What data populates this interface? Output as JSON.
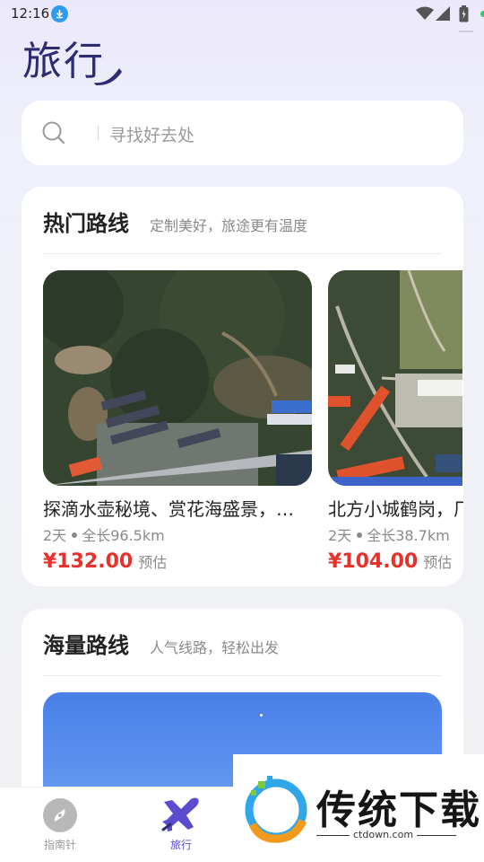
{
  "status_bar": {
    "time": "12:16"
  },
  "header": {
    "title": "旅行"
  },
  "search": {
    "placeholder": "寻找好去处"
  },
  "hot_routes": {
    "title": "热门路线",
    "subtitle": "定制美好，旅途更有温度",
    "items": [
      {
        "name": "探滴水壶秘境、赏花海盛景，…",
        "days": "2天",
        "length": "全长96.5km",
        "price": "¥132.00",
        "estimate": "预估"
      },
      {
        "name": "北方小城鹤岗，厂",
        "days": "2天",
        "length": "全长38.7km",
        "price": "¥104.00",
        "estimate": "预估"
      }
    ]
  },
  "mass_routes": {
    "title": "海量路线",
    "subtitle": "人气线路，轻松出发"
  },
  "tabbar": {
    "tabs": [
      {
        "label": "指南针",
        "icon": "compass-icon",
        "active": false
      },
      {
        "label": "旅行",
        "icon": "plane-icon",
        "active": true
      }
    ],
    "active_color": "#5b4ccf",
    "inactive_color": "#9a9a9a"
  },
  "watermark": {
    "text": "传统下载",
    "url": "ctdown.com"
  },
  "colors": {
    "title": "#2d2b72",
    "price": "#e8312c",
    "accent": "#5b4ccf"
  }
}
